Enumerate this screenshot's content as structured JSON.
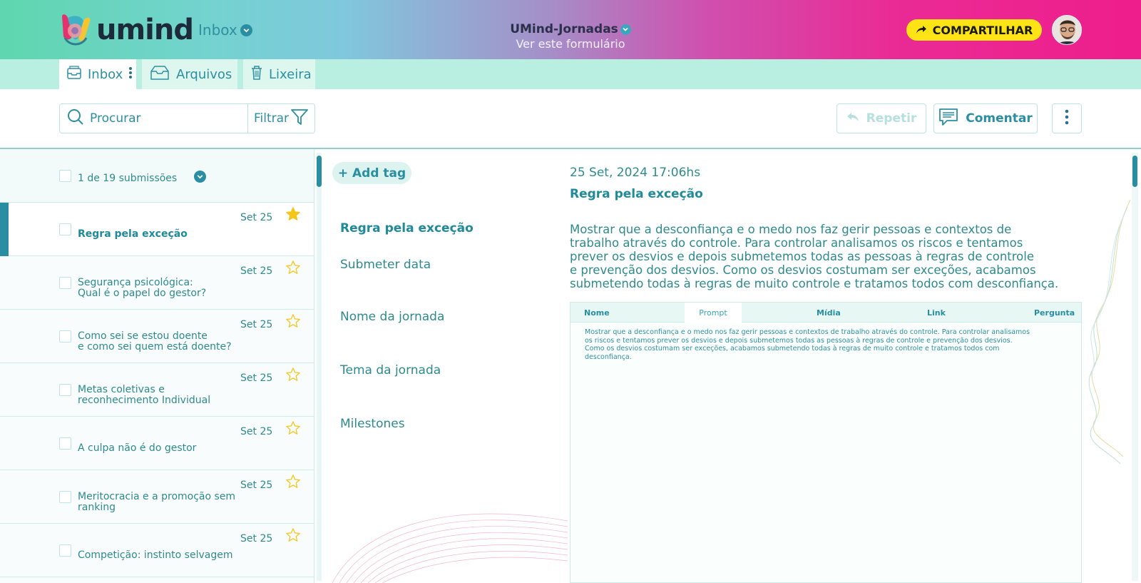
{
  "header": {
    "logo_text": "umind",
    "section_title": "Inbox",
    "form_name": "UMind-Jornadas",
    "form_link": "Ver este formulário",
    "share_label": "COMPARTILHAR"
  },
  "tabs": [
    {
      "label": "Inbox",
      "icon": "inbox-icon",
      "active": true
    },
    {
      "label": "Arquivos",
      "icon": "archive-icon",
      "active": false
    },
    {
      "label": "Lixeira",
      "icon": "trash-icon",
      "active": false
    }
  ],
  "toolbar": {
    "search_placeholder": "Procurar",
    "filter_label": "Filtrar",
    "repeat_label": "Repetir",
    "comment_label": "Comentar"
  },
  "list": {
    "count_label": "1 de 19 submissões",
    "items": [
      {
        "title_line1": "Regra pela exceção",
        "title_line2": "",
        "date": "Set 25",
        "starred": true,
        "selected": true
      },
      {
        "title_line1": "Segurança psicológica:",
        "title_line2": "Qual é o papel do gestor?",
        "date": "Set 25",
        "starred": false,
        "selected": false
      },
      {
        "title_line1": "Como sei se estou doente",
        "title_line2": "e como sei quem está doente?",
        "date": "Set 25",
        "starred": false,
        "selected": false
      },
      {
        "title_line1": "Metas coletivas e",
        "title_line2": "reconhecimento Individual",
        "date": "Set 25",
        "starred": false,
        "selected": false
      },
      {
        "title_line1": "A culpa não é do gestor",
        "title_line2": "",
        "date": "Set 25",
        "starred": false,
        "selected": false
      },
      {
        "title_line1": "Meritocracia e a promoção sem",
        "title_line2": "ranking",
        "date": "Set 25",
        "starred": false,
        "selected": false
      },
      {
        "title_line1": "Competição: instinto selvagem",
        "title_line2": "",
        "date": "Set 25",
        "starred": false,
        "selected": false
      }
    ]
  },
  "detail": {
    "add_tag_label": "+ Add tag",
    "labels": {
      "title": "Regra pela exceção",
      "submit_date": "Submeter data",
      "journey_name": "Nome da jornada",
      "journey_theme": "Tema da jornada",
      "milestones": "Milestones"
    },
    "date_value": "25 Set, 2024 17:06hs",
    "title_value": "Regra pela exceção",
    "description_lines": [
      "Mostrar que a desconfiança e o medo nos faz gerir pessoas e contextos de",
      "trabalho através do controle. Para controlar analisamos os riscos e tentamos",
      "prever os desvios e depois submetemos todas as pessoas à regras de controle",
      "e prevenção dos desvios. Como os desvios costumam ser exceções, acabamos",
      "submetendo todas à regras de muito controle e tratamos todos com desconfiança."
    ],
    "table": {
      "columns": [
        "Nome",
        "Prompt",
        "Mídia",
        "Link",
        "Pergunta"
      ],
      "active_column": "Prompt",
      "body_lines": [
        "Mostrar que a desconfiança e o medo nos faz gerir pessoas e contextos de trabalho através do controle. Para controlar analisamos",
        "os riscos e tentamos prever os desvios e depois submetemos todas as pessoas à regras de controle e prevenção dos desvios.",
        "Como os desvios costumam ser exceções, acabamos submetendo todas à regras de muito controle e tratamos todos com",
        "desconfiança."
      ]
    }
  },
  "colors": {
    "accent": "#2a8ea3",
    "share_button": "#ffe415",
    "star": "#f5c518"
  }
}
